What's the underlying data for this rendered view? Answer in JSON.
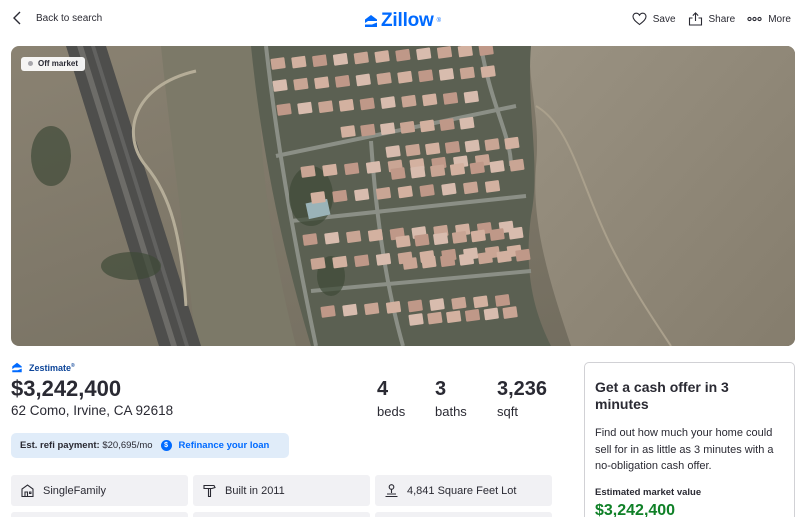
{
  "header": {
    "back_label": "Back to search",
    "logo_text": "Zillow",
    "logo_mark": "®",
    "actions": {
      "save": "Save",
      "share": "Share",
      "more": "More"
    }
  },
  "photo": {
    "badge": "Off market"
  },
  "zestimate": {
    "label": "Zestimate",
    "mark": "®",
    "price": "$3,242,400",
    "address": "62 Como, Irvine, CA 92618"
  },
  "facts": [
    {
      "value": "4",
      "label": "beds"
    },
    {
      "value": "3",
      "label": "baths"
    },
    {
      "value": "3,236",
      "label": "sqft"
    }
  ],
  "refi": {
    "label": "Est. refi payment:",
    "amount": "$20,695/mo",
    "icon_text": "$",
    "link": "Refinance your loan"
  },
  "chips": [
    {
      "text": "SingleFamily",
      "icon": "home-icon"
    },
    {
      "text": "Built in 2011",
      "icon": "hammer-icon"
    },
    {
      "text": "4,841 Square Feet Lot",
      "icon": "lot-size-icon"
    }
  ],
  "cash_offer": {
    "title": "Get a cash offer in 3 minutes",
    "body": "Find out how much your home could sell for in as little as 3 minutes with a no-obligation cash offer.",
    "market_label": "Estimated market value",
    "market_value": "$3,242,400"
  },
  "colors": {
    "brand": "#006aff",
    "zestimate": "#0d4599",
    "value_green": "#0f8027"
  }
}
